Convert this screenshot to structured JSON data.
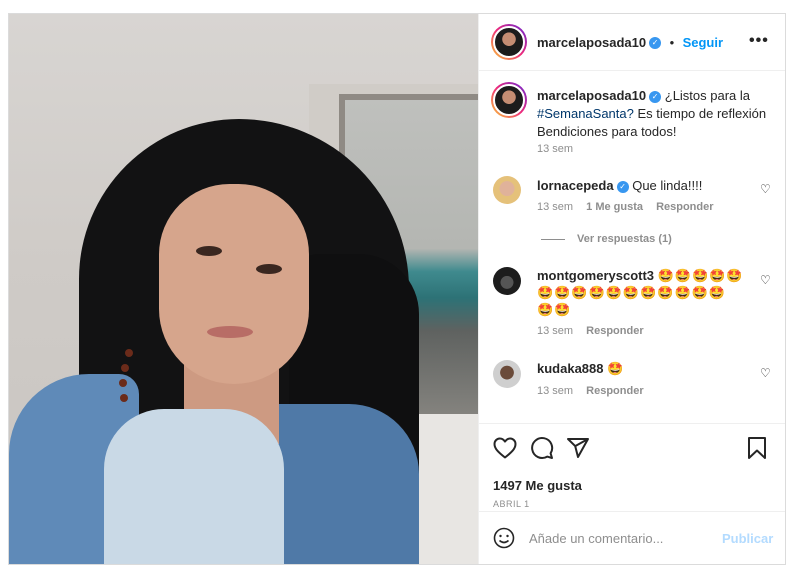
{
  "post": {
    "username": "marcelaposada10",
    "follow_label": "Seguir",
    "more_label": "•••",
    "caption_prefix": "¿Listos para la",
    "caption_hashtag": "#SemanaSanta?",
    "caption_rest": " Es tiempo de reflexión Bendiciones para todos!",
    "caption_time": "13 sem"
  },
  "comments": [
    {
      "username": "lornacepeda",
      "verified": true,
      "text": "Que linda!!!!",
      "time": "13 sem",
      "likes": "1 Me gusta",
      "reply": "Responder",
      "view_replies": "Ver respuestas (1)"
    },
    {
      "username": "montgomeryscott3",
      "verified": false,
      "text_line1": "🤩🤩🤩🤩🤩",
      "text_line2": "🤩🤩🤩🤩🤩🤩🤩🤩🤩🤩🤩",
      "text_line3": "🤩🤩",
      "time": "13 sem",
      "reply": "Responder"
    },
    {
      "username": "kudaka888",
      "verified": false,
      "text": "🤩",
      "time": "13 sem",
      "reply": "Responder"
    }
  ],
  "actions": {
    "likes_count": "1497 Me gusta",
    "date": "ABRIL 1"
  },
  "add_comment": {
    "placeholder": "Añade un comentario...",
    "publish_label": "Publicar"
  },
  "colors": {
    "link_blue": "#0095f6",
    "verified_blue": "#3897f0",
    "publish_disabled": "#b3dbff"
  }
}
